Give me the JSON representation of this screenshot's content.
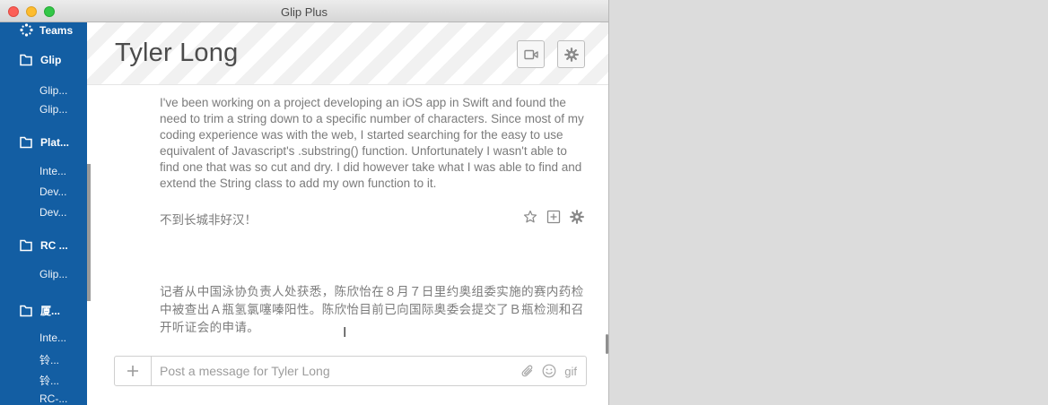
{
  "window": {
    "title": "Glip Plus"
  },
  "sidebar": {
    "teams_label": "Teams",
    "groups": [
      {
        "label": "Glip",
        "items": [
          "Glip...",
          "Glip..."
        ]
      },
      {
        "label": "Plat...",
        "items": [
          "Inte...",
          "Dev...",
          "Dev..."
        ]
      },
      {
        "label": "RC ...",
        "items": [
          "Glip..."
        ]
      },
      {
        "label": "厦...",
        "items": [
          "Inte...",
          "铃...",
          "铃...",
          "RC-..."
        ]
      }
    ]
  },
  "header": {
    "contact_name": "Tyler Long"
  },
  "messages": [
    {
      "text": "I've been working on a project developing an iOS app in Swift and found the need to trim a string down to a specific number of characters. Since most of my coding experience was with the web, I started searching for the easy to use equivalent of Javascript's .substring() function. Unfortunately I wasn't able to find one that was so cut and dry. I did however take what I was able to find and extend the String class to add my own function to it."
    },
    {
      "text": "不到长城非好汉！"
    },
    {
      "text": "记者从中国泳协负责人处获悉，陈欣怡在８月７日里约奥组委实施的赛内药检中被查出Ａ瓶氢氯噻嗪阳性。陈欣怡目前已向国际奥委会提交了Ｂ瓶检测和召开听证会的申请。"
    }
  ],
  "composer": {
    "placeholder": "Post a message for Tyler Long",
    "value": "",
    "gif_label": "gif"
  },
  "icons": {
    "teams": "teams-icon",
    "folder": "folder-icon",
    "video": "video-icon",
    "settings": "gear-icon",
    "star": "star-icon",
    "add": "plus-square-icon",
    "attach": "paperclip-icon",
    "emoji": "smiley-icon"
  },
  "colors": {
    "sidebar": "#135ea3",
    "text": "#7b7b7b"
  }
}
